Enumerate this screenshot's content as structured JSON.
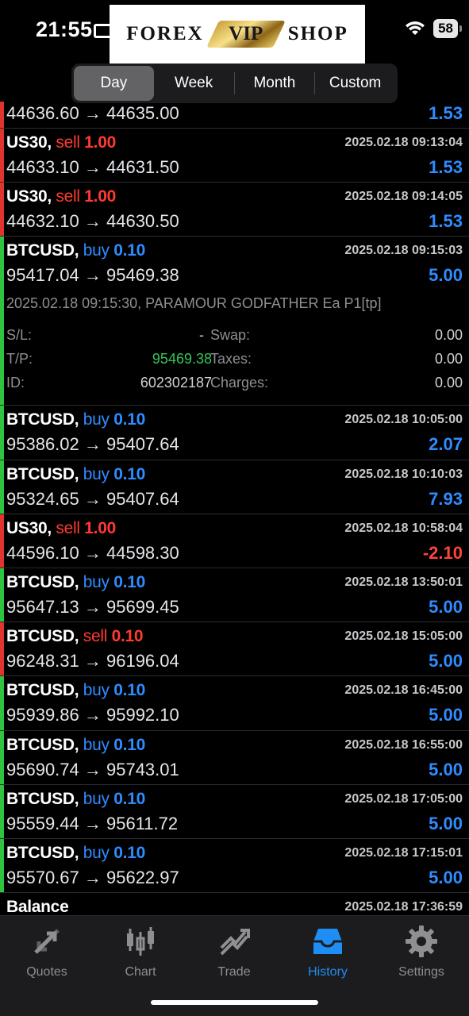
{
  "status": {
    "time": "21:55",
    "battery": "58"
  },
  "logo": {
    "left": "FOREX",
    "badge": "VIP",
    "right": "SHOP"
  },
  "segments": [
    "Day",
    "Week",
    "Month",
    "Custom"
  ],
  "top_partial": {
    "prices": "44636.60 → 44635.00",
    "profit": "1.53"
  },
  "rows": [
    {
      "symbol": "US30,",
      "side": "sell",
      "volume": "1.00",
      "time": "2025.02.18 09:13:04",
      "prices": "44633.10 → 44631.50",
      "profit": "1.53"
    },
    {
      "symbol": "US30,",
      "side": "sell",
      "volume": "1.00",
      "time": "2025.02.18 09:14:05",
      "prices": "44632.10 → 44630.50",
      "profit": "1.53"
    },
    {
      "symbol": "BTCUSD,",
      "side": "buy",
      "volume": "0.10",
      "time": "2025.02.18 09:15:03",
      "prices": "95417.04 → 95469.38",
      "profit": "5.00"
    },
    {
      "symbol": "BTCUSD,",
      "side": "buy",
      "volume": "0.10",
      "time": "2025.02.18 10:05:00",
      "prices": "95386.02 → 95407.64",
      "profit": "2.07"
    },
    {
      "symbol": "BTCUSD,",
      "side": "buy",
      "volume": "0.10",
      "time": "2025.02.18 10:10:03",
      "prices": "95324.65 → 95407.64",
      "profit": "7.93"
    },
    {
      "symbol": "US30,",
      "side": "sell",
      "volume": "1.00",
      "time": "2025.02.18 10:58:04",
      "prices": "44596.10 → 44598.30",
      "profit": "-2.10"
    },
    {
      "symbol": "BTCUSD,",
      "side": "buy",
      "volume": "0.10",
      "time": "2025.02.18 13:50:01",
      "prices": "95647.13 → 95699.45",
      "profit": "5.00"
    },
    {
      "symbol": "BTCUSD,",
      "side": "sell",
      "volume": "0.10",
      "time": "2025.02.18 15:05:00",
      "prices": "96248.31 → 96196.04",
      "profit": "5.00"
    },
    {
      "symbol": "BTCUSD,",
      "side": "buy",
      "volume": "0.10",
      "time": "2025.02.18 16:45:00",
      "prices": "95939.86 → 95992.10",
      "profit": "5.00"
    },
    {
      "symbol": "BTCUSD,",
      "side": "buy",
      "volume": "0.10",
      "time": "2025.02.18 16:55:00",
      "prices": "95690.74 → 95743.01",
      "profit": "5.00"
    },
    {
      "symbol": "BTCUSD,",
      "side": "buy",
      "volume": "0.10",
      "time": "2025.02.18 17:05:00",
      "prices": "95559.44 → 95611.72",
      "profit": "5.00"
    },
    {
      "symbol": "BTCUSD,",
      "side": "buy",
      "volume": "0.10",
      "time": "2025.02.18 17:15:01",
      "prices": "95570.67 → 95622.97",
      "profit": "5.00"
    }
  ],
  "expanded": {
    "comment": "2025.02.18 09:15:30, PARAMOUR GODFATHER Ea P1[tp]",
    "sl_label": "S/L:",
    "sl_value": "-",
    "tp_label": "T/P:",
    "tp_value": "95469.38",
    "id_label": "ID:",
    "id_value": "602302187",
    "swap_label": "Swap:",
    "swap_value": "0.00",
    "taxes_label": "Taxes:",
    "taxes_value": "0.00",
    "charges_label": "Charges:",
    "charges_value": "0.00"
  },
  "balance": {
    "label": "Balance",
    "time": "2025.02.18 17:36:59"
  },
  "tabs": [
    {
      "label": "Quotes",
      "icon": "quotes-icon"
    },
    {
      "label": "Chart",
      "icon": "chart-icon"
    },
    {
      "label": "Trade",
      "icon": "trade-icon"
    },
    {
      "label": "History",
      "icon": "history-icon"
    },
    {
      "label": "Settings",
      "icon": "settings-icon"
    }
  ],
  "active_tab": "History",
  "colors": {
    "sell": "#ff3b30",
    "buy": "#2f8cff",
    "tp": "#34c759",
    "accent": "#1e8ef5"
  }
}
